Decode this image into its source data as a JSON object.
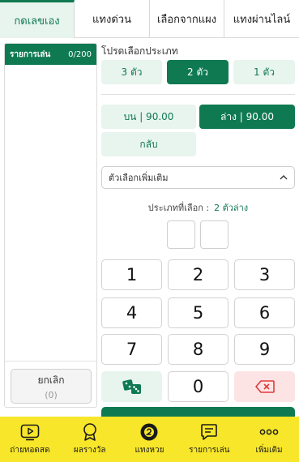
{
  "tabs": [
    {
      "label": "กดเลขเอง",
      "active": true
    },
    {
      "label": "แทงด่วน",
      "active": false
    },
    {
      "label": "เลือกจากแผง",
      "active": false
    },
    {
      "label": "แทงผ่านไลน์",
      "active": false
    }
  ],
  "list_panel": {
    "title": "รายการเล่น",
    "count": "0/200",
    "cancel_label": "ยกเลิก",
    "cancel_count": "(0)"
  },
  "type_section": {
    "label": "โปรดเลือกประเภท",
    "options": [
      "3 ตัว",
      "2 ตัว",
      "1 ตัว"
    ],
    "selected": "2 ตัว"
  },
  "position_section": {
    "options": [
      "บน | 90.00",
      "ล่าง | 90.00"
    ],
    "selected": "ล่าง | 90.00",
    "reverse_label": "กลับ"
  },
  "more_options": {
    "label": "ตัวเลือกเพิ่มเติม",
    "icon": "chevron-up-icon"
  },
  "selected_type": {
    "label": "ประเภทที่เลือก :",
    "value": "2 ตัวล่าง"
  },
  "keypad": {
    "keys": [
      "1",
      "2",
      "3",
      "4",
      "5",
      "6",
      "7",
      "8",
      "9"
    ],
    "zero": "0",
    "dice_icon": "dice-icon",
    "delete_icon": "backspace-icon"
  },
  "bottom_nav": [
    {
      "label": "ถ่ายทอดสด",
      "icon": "play-icon"
    },
    {
      "label": "ผลรางวัล",
      "icon": "award-icon"
    },
    {
      "label": "แทงหวย",
      "icon": "lottery-ball-icon"
    },
    {
      "label": "รายการเล่น",
      "icon": "list-icon"
    },
    {
      "label": "เพิ่มเติม",
      "icon": "more-icon"
    }
  ],
  "colors": {
    "primary": "#0f7a52",
    "primary_light": "#e8f4ee",
    "nav_background": "#f7e629",
    "delete_background": "#fde4e4",
    "delete_icon": "#e03a3a"
  }
}
